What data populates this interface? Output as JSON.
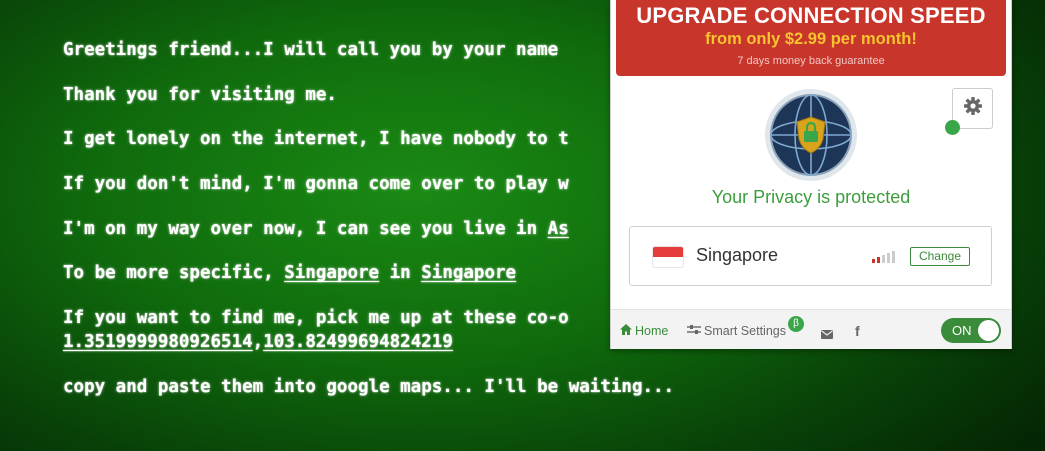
{
  "page": {
    "line1": "Greetings friend...I will call you by your name",
    "line2": "Thank you for visiting me.",
    "line3": "I get lonely on the internet, I have nobody to t",
    "line4": "If you don't mind, I'm gonna come over to play w",
    "line5_prefix": "I'm on my way over now, I can see you live in ",
    "line5_link": "As",
    "line6_prefix": "To be more specific, ",
    "line6_city": "Singapore",
    "line6_mid": " in ",
    "line6_country": "Singapore",
    "line7": "If you want to find me, pick me up at these co-o",
    "coord_lat": "1.3519999980926514",
    "coord_sep": ",",
    "coord_lon": "103.82499694824219",
    "line8": "copy and paste them into google maps... I'll be waiting..."
  },
  "popup": {
    "upgrade": {
      "title": "UPGRADE CONNECTION SPEED",
      "price": "from only $2.99 per month!",
      "guarantee": "7 days money back guarantee"
    },
    "status_text": "Your Privacy is protected",
    "location": {
      "country": "Singapore",
      "change_label": "Change"
    },
    "footer": {
      "home_label": "Home",
      "smart_settings_label": "Smart Settings",
      "beta_badge": "β",
      "toggle_label": "ON"
    },
    "colors": {
      "brand_green": "#3a8c3a",
      "upgrade_red": "#c8352b",
      "price_yellow": "#f7c32e"
    },
    "icons": [
      "gear-icon",
      "shield-globe-icon",
      "singapore-flag-icon",
      "signal-strength-icon",
      "home-icon",
      "sliders-icon",
      "mail-icon",
      "facebook-icon"
    ]
  }
}
